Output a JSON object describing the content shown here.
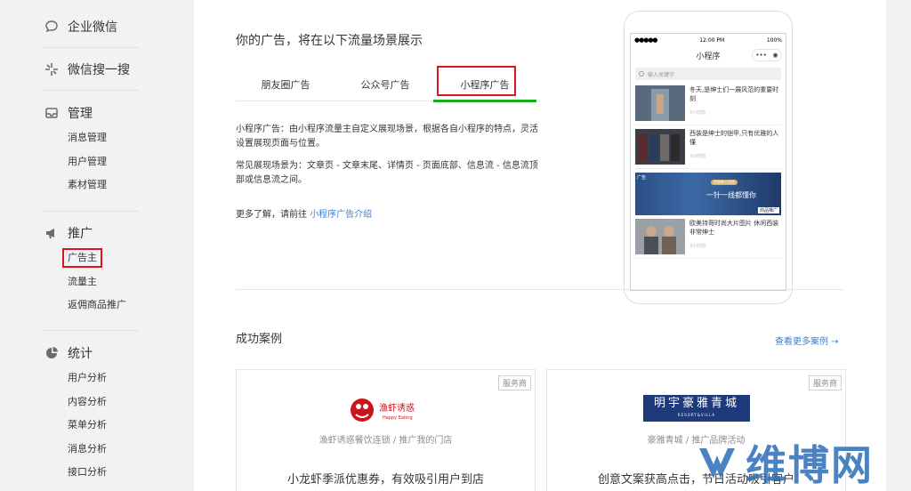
{
  "sidebar": {
    "groups": [
      {
        "label": "企业微信",
        "icon": "chat-bubble-icon",
        "items": []
      },
      {
        "label": "微信搜一搜",
        "icon": "sparkle-icon",
        "items": []
      },
      {
        "label": "管理",
        "icon": "inbox-icon",
        "items": [
          "消息管理",
          "用户管理",
          "素材管理"
        ]
      },
      {
        "label": "推广",
        "icon": "megaphone-icon",
        "items": [
          "广告主",
          "流量主",
          "返佣商品推广"
        ]
      },
      {
        "label": "统计",
        "icon": "pie-chart-icon",
        "items": [
          "用户分析",
          "内容分析",
          "菜单分析",
          "消息分析",
          "接口分析"
        ]
      }
    ],
    "active_item": "广告主"
  },
  "main": {
    "scene_title": "你的广告，将在以下流量场景展示",
    "tabs": [
      {
        "label": "朋友圈广告"
      },
      {
        "label": "公众号广告"
      },
      {
        "label": "小程序广告",
        "active": true
      }
    ],
    "description_1": "小程序广告：由小程序流量主自定义展现场景，根据各自小程序的特点，灵活设置展现页面与位置。",
    "description_2": "常见展现场景为：文章页 - 文章末尾、详情页 - 页面底部、信息流 - 信息流顶部或信息流之间。",
    "more_prefix": "更多了解，请前往",
    "more_link": "小程序广告介绍"
  },
  "phone": {
    "carrier": "●●●●●",
    "time": "12:00 PM",
    "battery": "100%",
    "app_title": "小程序",
    "search_placeholder": "输入关键字",
    "articles": [
      {
        "title": "冬天,是绅士们一展风范的重要时刻",
        "time": "3小时前"
      },
      {
        "title": "西装是绅士的铠甲,只有优雅的人懂",
        "time": "3小时前"
      }
    ],
    "ad": {
      "tag": "广告",
      "pill": "西装绅士优选",
      "slogan": "一针一线都懂你",
      "label": "商品推广"
    },
    "article_after_ad": {
      "title": "欧美持哥时尚大片图片 休闲西装非常绅士",
      "time": "3小时前"
    }
  },
  "cases": {
    "title": "成功案例",
    "more": "查看更多案例 →",
    "items": [
      {
        "badge": "服务商",
        "logo_text": "渔虾诱惑",
        "logo_sub": "Happy Eating",
        "subtitle": "渔虾诱惑餐饮连锁 / 推广我的门店",
        "headline": "小龙虾季派优惠券，有效吸引用户到店"
      },
      {
        "badge": "服务商",
        "logo_text": "明宇豪雅青城",
        "logo_sub": "RESORT&VILLA",
        "subtitle": "豪雅青城 / 推广品牌活动",
        "headline": "创意文案获高点击，节日活动吸引客户"
      }
    ]
  },
  "watermark": {
    "text": "维博网"
  },
  "colors": {
    "accent_green": "#1aad19",
    "highlight_red": "#e0141e",
    "link_blue": "#3a7fd6"
  }
}
